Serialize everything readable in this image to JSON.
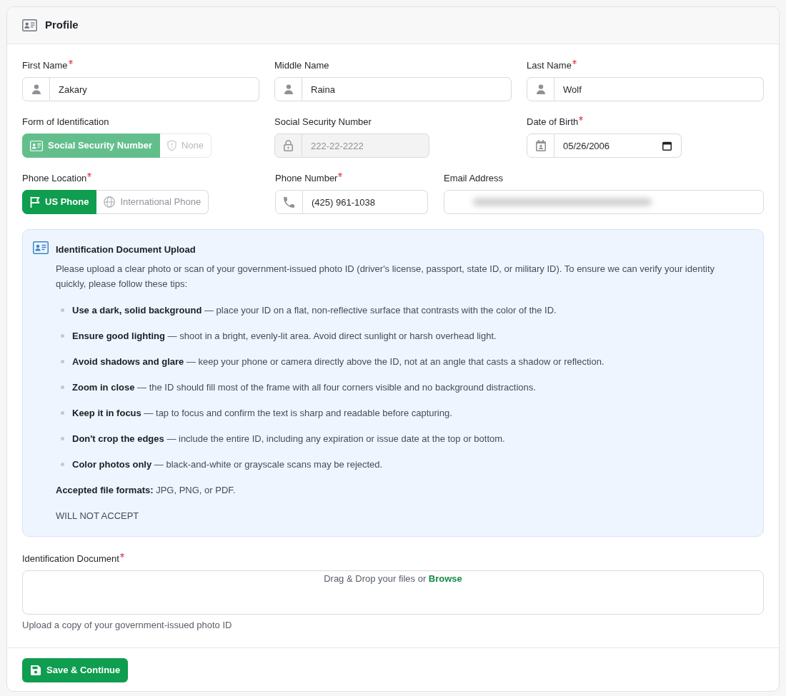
{
  "header": {
    "title": "Profile"
  },
  "rows": [
    [
      {
        "kind": "text",
        "label": "First Name",
        "required": true,
        "disabled": false,
        "value": "Zakary"
      },
      {
        "kind": "text",
        "label": "Middle Name",
        "required": false,
        "disabled": false,
        "value": "Raina"
      },
      {
        "kind": "text",
        "label": "Last Name",
        "required": true,
        "disabled": false,
        "value": "Wolf"
      }
    ],
    [
      {
        "kind": "toggle",
        "label": "Form of Identification",
        "required": false,
        "disabled": true,
        "options": [
          {
            "label": "Social Security Number",
            "selected": true
          },
          {
            "label": "None",
            "selected": false
          }
        ]
      },
      {
        "kind": "ssn",
        "label": "Social Security Number",
        "required": false,
        "disabled": true,
        "placeholder": "222-22-2222"
      },
      {
        "kind": "date",
        "label": "Date of Birth",
        "required": true,
        "disabled": false,
        "value": "05/26/2006"
      }
    ],
    [
      {
        "kind": "toggle",
        "label": "Phone Location",
        "required": true,
        "disabled": false,
        "options": [
          {
            "label": "US Phone",
            "selected": true
          },
          {
            "label": "International Phone",
            "selected": false
          }
        ]
      },
      {
        "kind": "phone",
        "label": "Phone Number",
        "required": true,
        "disabled": false,
        "value": "(425) 961-1038"
      },
      {
        "kind": "email",
        "label": "Email Address",
        "required": false,
        "disabled": false,
        "redacted": true
      }
    ]
  ],
  "notice": {
    "title": "Identification Document Upload",
    "intro": "Please upload a clear photo or scan of your government-issued photo ID (driver's license, passport, state ID, or military ID). To ensure we can verify your identity quickly, please follow these tips:",
    "tips": [
      "**Use a dark, solid background** — place your ID on a flat, non-reflective surface that contrasts with the color of the ID.",
      "**Ensure good lighting** — shoot in a bright, evenly-lit area. Avoid direct sunlight or harsh overhead light.",
      "**Avoid shadows and glare** — keep your phone or camera directly above the ID, not at an angle that casts a shadow or reflection.",
      "**Zoom in close** — the ID should fill most of the frame with all four corners visible and no background distractions.",
      "**Keep it in focus** — tap to focus and confirm the text is sharp and readable before capturing.",
      "**Don't crop the edges** — include the entire ID, including any expiration or issue date at the top or bottom.",
      "**Color photos only** — black-and-white or grayscale scans may be rejected."
    ],
    "formats": "**Accepted file formats:** JPG, PNG, or PDF.",
    "warning": "WILL NOT ACCEPT"
  },
  "upload": {
    "label": "Identification Document",
    "required": true,
    "prompt": "Drag & Drop your files or",
    "link": "Browse",
    "help": "Upload a copy of your government-issued photo ID"
  },
  "footer": {
    "button": "Save & Continue"
  }
}
